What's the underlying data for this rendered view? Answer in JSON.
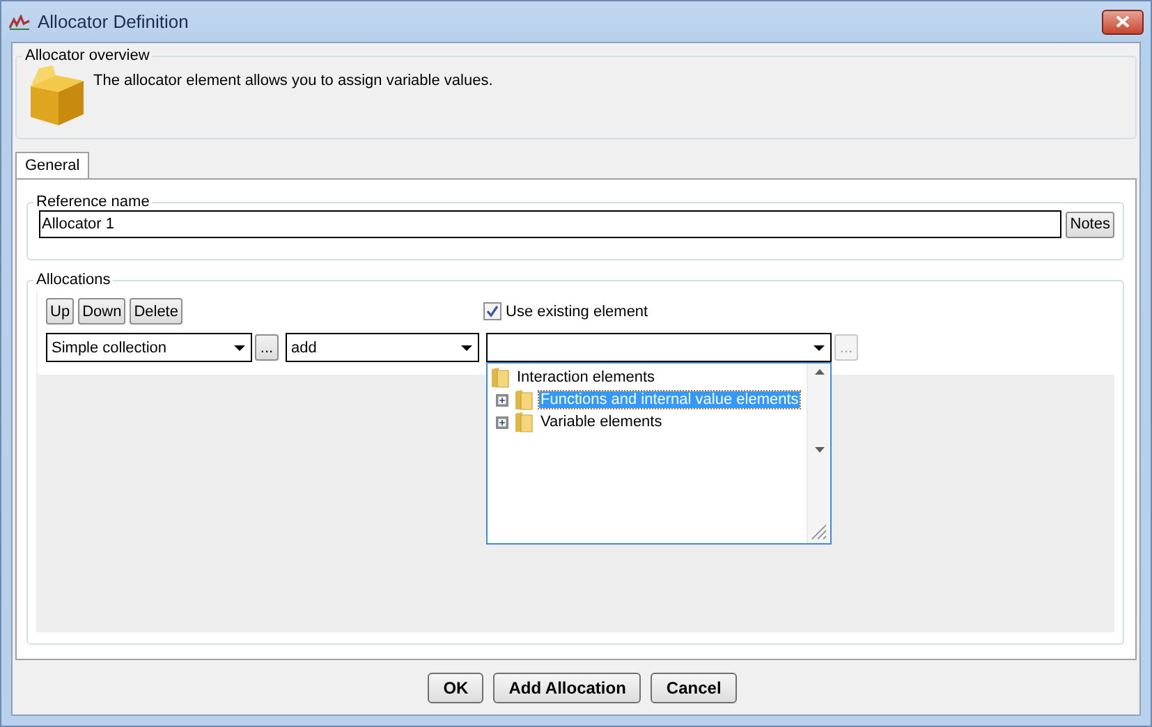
{
  "window": {
    "title": "Allocator Definition"
  },
  "overview": {
    "title": "Allocator overview",
    "description": "The allocator element allows you to assign variable values."
  },
  "tabs": [
    {
      "label": "General",
      "selected": true
    }
  ],
  "reference": {
    "title": "Reference name",
    "value": "Allocator 1",
    "notes_button": "Notes"
  },
  "allocations": {
    "title": "Allocations",
    "buttons": [
      "Up",
      "Down",
      "Delete"
    ],
    "use_existing": {
      "label": "Use existing element",
      "checked": true
    },
    "collection_combo": {
      "value": "Simple collection"
    },
    "collection_browse": {
      "label": "...",
      "disabled": false
    },
    "operation_combo": {
      "value": "add"
    },
    "element_combo": {
      "expanded": true
    },
    "element_browse": {
      "label": "...",
      "disabled": true
    },
    "tree": [
      {
        "label": "Interaction elements",
        "selected": false,
        "children": [
          {
            "label": "Functions and internal value elements",
            "expanded": false,
            "selected": true
          },
          {
            "label": "Variable elements",
            "expanded": false,
            "selected": false
          }
        ]
      }
    ]
  },
  "buttons": [
    "OK",
    "Add Allocation",
    "Cancel"
  ]
}
